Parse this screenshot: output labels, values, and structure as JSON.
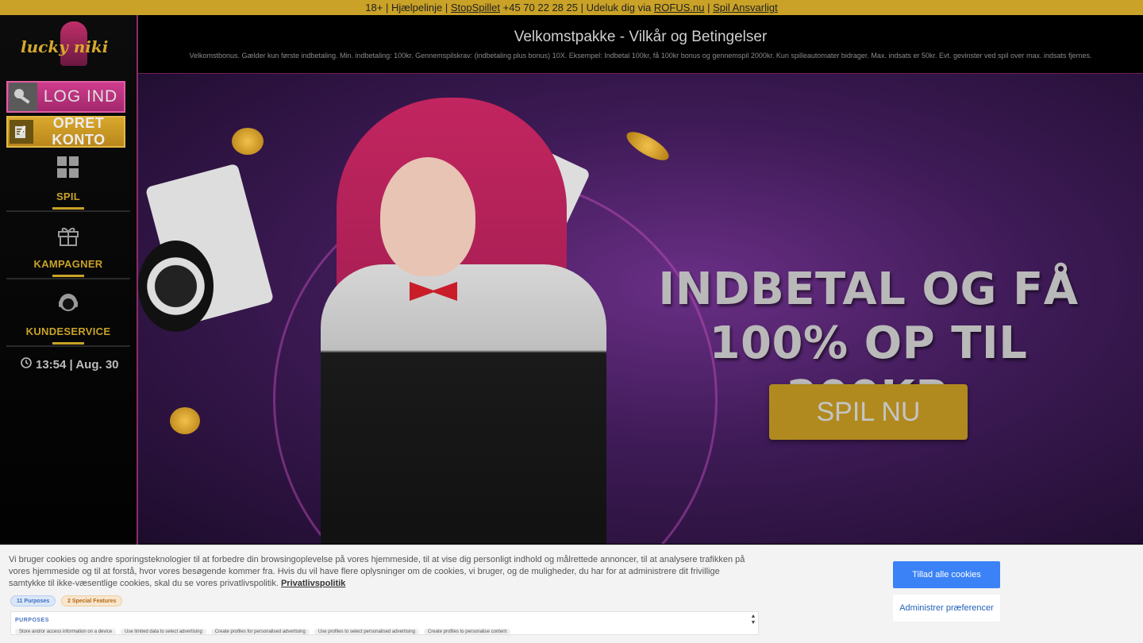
{
  "topbar": {
    "age": "18+",
    "sep1": " | ",
    "helpline_label": "Hjælpelinje",
    "sep2": " | ",
    "stopspillet": "StopSpillet",
    "phone": " +45 70 22 28 25 ",
    "sep3": "| ",
    "exclude_text": "Udeluk dig via ",
    "rofus": "ROFUS.nu",
    "sep4": " | ",
    "responsible": "Spil Ansvarligt"
  },
  "sidebar": {
    "logo_text": "lucky niki",
    "login_label": "LOG IND",
    "signup_label": "OPRET KONTO",
    "nav": [
      {
        "label": "SPIL",
        "icon": "grid-icon"
      },
      {
        "label": "KAMPAGNER",
        "icon": "gift-icon"
      },
      {
        "label": "KUNDESERVICE",
        "icon": "headset-icon"
      }
    ],
    "clock": "13:54 | Aug. 30"
  },
  "terms": {
    "title": "Velkomstpakke - Vilkår og Betingelser",
    "text": "Velkomstbonus. Gælder kun første indbetaling. Min. indbetaling: 100kr. Gennemspilskrav: (indbetaling plus bonus) 10X. Eksempel: Indbetal 100kr, få 100kr bonus og gennemspil 2000kr. Kun spilleautomater bidrager. Max. indsats er 50kr. Evt. gevinster ved spil over max. indsats fjernes."
  },
  "banner": {
    "headline_line1": "INDBETAL OG FÅ",
    "headline_line2": "100% OP TIL 200KR",
    "cta_label": "SPIL NU"
  },
  "cookie": {
    "text": "Vi bruger cookies og andre sporingsteknologier til at forbedre din browsingoplevelse på vores hjemmeside, til at vise dig personligt indhold og målrettede annoncer, til at analysere trafikken på vores hjemmeside og til at forstå, hvor vores besøgende kommer fra. Hvis du vil have flere oplysninger om de cookies, vi bruger, og de muligheder, du har for at administrere dit frivillige samtykke til ikke-væsentlige cookies, skal du se vores privatlivspolitik. ",
    "privacy_link": "Privatlivspolitik",
    "purposes_count": "11 Purposes",
    "special_count": "2 Special Features",
    "purposes_heading": "PURPOSES",
    "tags": [
      "Store and/or access information on a device",
      "Use limited data to select advertising",
      "Create profiles for personalised advertising",
      "Use profiles to select personalised advertising",
      "Create profiles to personalise content"
    ],
    "allow_label": "Tillad alle cookies",
    "manage_label": "Administrer præferencer"
  },
  "colors": {
    "gold": "#c9a227",
    "pink": "#cf3c8c",
    "blue": "#3b82f6"
  }
}
